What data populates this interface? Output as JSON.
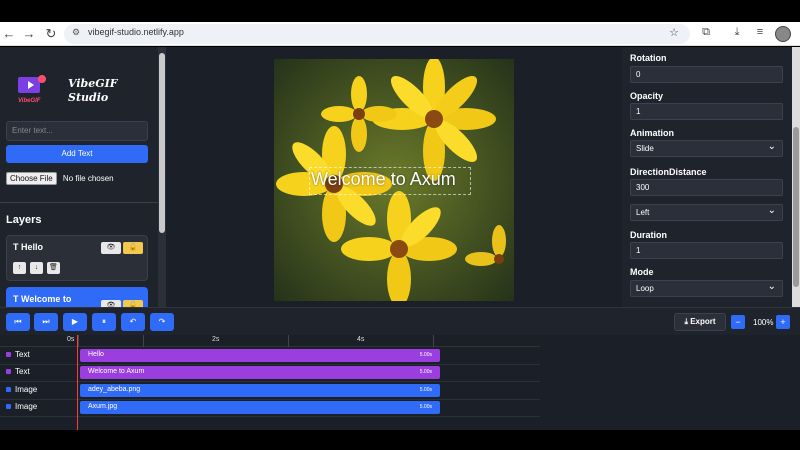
{
  "browser": {
    "url": "vibegif-studio.netlify.app"
  },
  "sidebar": {
    "logo_text": "VibeGIF",
    "title_line1": "VibeGIF",
    "title_line2": "Studio",
    "text_placeholder": "Enter text...",
    "add_text_label": "Add Text",
    "choose_file_label": "Choose File",
    "no_file_label": "No file chosen",
    "layers_heading": "Layers",
    "layers": [
      {
        "name": "T Hello"
      },
      {
        "name": "T Welcome to"
      }
    ],
    "icons": {
      "eye": "👁",
      "lock": "🔓",
      "up": "↑",
      "down": "↓",
      "delete": "🗑"
    }
  },
  "canvas": {
    "overlay_text": "Welcome to Axum"
  },
  "properties": {
    "rotation_label": "Rotation",
    "rotation_value": "0",
    "opacity_label": "Opacity",
    "opacity_value": "1",
    "animation_label": "Animation",
    "animation_value": "Slide",
    "direction_distance_label": "DirectionDistance",
    "direction_distance_value": "300",
    "direction_value": "Left",
    "duration_label": "Duration",
    "duration_value": "1",
    "mode_label": "Mode",
    "mode_value": "Loop"
  },
  "controls": {
    "skip_back": "⏮",
    "skip_forward": "⏭",
    "play": "▶",
    "pause": "⏸",
    "undo": "↶",
    "redo": "↷",
    "export_label": "Export",
    "zoom_out": "−",
    "zoom_in": "+",
    "zoom_value": "100%"
  },
  "timeline": {
    "ticks": [
      "0s",
      "2s",
      "4s"
    ],
    "tracks": [
      {
        "type": "Text",
        "clip": "Hello",
        "duration": "5.00s",
        "color": "#9b3ee0"
      },
      {
        "type": "Text",
        "clip": "Welcome to Axum",
        "duration": "5.00s",
        "color": "#9b3ee0"
      },
      {
        "type": "Image",
        "clip": "adey_abeba.png",
        "duration": "5.00s",
        "color": "#2f6bf6"
      },
      {
        "type": "Image",
        "clip": "Axum.jpg",
        "duration": "5.00s",
        "color": "#2f6bf6"
      }
    ]
  },
  "colors": {
    "accent": "#2f6bf6",
    "text_clip": "#9b3ee0",
    "image_clip": "#2f6bf6",
    "playhead": "#ff3b3b"
  }
}
